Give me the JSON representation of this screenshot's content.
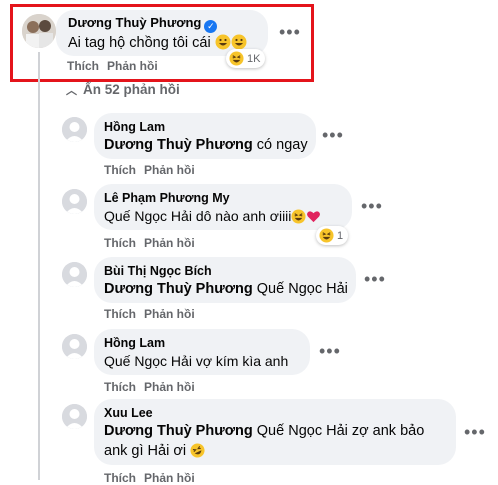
{
  "comments": [
    {
      "author": "Dương Thuỳ Phương",
      "text": "Ai tag hộ chồng tôi cái",
      "reaction_count": "1K",
      "actions": {
        "like": "Thích",
        "reply": "Phản hồi"
      }
    }
  ],
  "hide_replies_label": "Ẩn 52 phản hồi",
  "replies": [
    {
      "author": "Hồng Lam",
      "tag": "Dương Thuỳ Phương",
      "text": "có ngay"
    },
    {
      "author": "Lê Phạm Phương My",
      "text": "Quế Ngọc Hải dô nào anh ơiiii",
      "reaction_count": "1"
    },
    {
      "author": "Bùi Thị Ngọc Bích",
      "tag": "Dương Thuỳ Phương",
      "text": "Quế Ngọc Hải"
    },
    {
      "author": "Hồng Lam",
      "text": "Quế Ngọc Hải vợ kím kìa anh"
    },
    {
      "author": "Xuu Lee",
      "tag": "Dương Thuỳ Phương",
      "text": "Quế Ngọc Hải zợ ank bảo",
      "text2": "ank gì Hải ơi"
    }
  ],
  "actions": {
    "like": "Thích",
    "reply": "Phản hồi"
  },
  "colors": {
    "highlight": "#e4141b",
    "bubble": "#f0f2f5",
    "verified": "#1877f2",
    "muted": "#65676b"
  },
  "icons": [
    "verified-badge-icon",
    "grinning-emoji-icon",
    "laughing-emoji-icon",
    "heart-emoji-icon",
    "chevron-up-icon",
    "more-icon"
  ]
}
